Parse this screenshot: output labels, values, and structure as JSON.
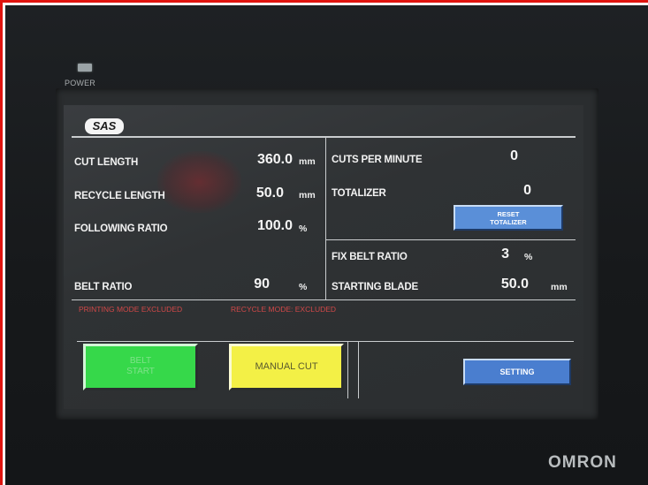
{
  "device": {
    "power_label": "POWER",
    "brand": "OMRON",
    "logo": "SAS"
  },
  "left_panel": {
    "cut_length": {
      "label": "CUT LENGTH",
      "value": "360.0",
      "unit": "mm"
    },
    "recycle_length": {
      "label": "RECYCLE LENGTH",
      "value": "50.0",
      "unit": "mm"
    },
    "following_ratio": {
      "label": "FOLLOWING RATIO",
      "value": "100.0",
      "unit": "%"
    },
    "belt_ratio": {
      "label": "BELT RATIO",
      "value": "90",
      "unit": "%"
    }
  },
  "right_panel": {
    "cuts_per_minute": {
      "label": "CUTS PER MINUTE",
      "value": "0"
    },
    "totalizer": {
      "label": "TOTALIZER",
      "value": "0"
    },
    "reset_button": {
      "line1": "RESET",
      "line2": "TOTALIZER"
    },
    "fix_belt_ratio": {
      "label": "FIX BELT RATIO",
      "value": "3",
      "unit": "%"
    },
    "starting_blade": {
      "label": "STARTING BLADE",
      "value": "50.0",
      "unit": "mm"
    }
  },
  "status": {
    "printing_mode": "PRINTING MODE EXCLUDED",
    "recycle_mode": "RECYCLE MODE: EXCLUDED"
  },
  "buttons": {
    "belt_start_line1": "BELT",
    "belt_start_line2": "START",
    "manual_cut": "MANUAL CUT",
    "setting": "SETTING"
  },
  "colors": {
    "belt_start": "#36d84a",
    "manual_cut": "#f3f046",
    "action_blue": "#4a7ecf",
    "status_red": "#d04848",
    "outline_red": "#e0140f"
  }
}
